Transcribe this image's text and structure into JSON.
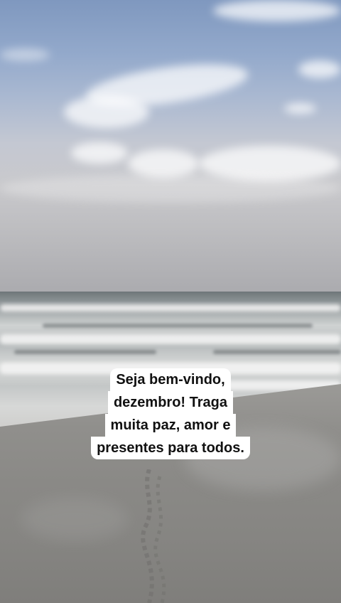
{
  "story": {
    "caption_lines": [
      "Seja bem-vindo,",
      "dezembro! Traga",
      "muita paz, amor e",
      "presentes para todos."
    ]
  },
  "colors": {
    "caption_background": "#ffffff",
    "caption_text": "#111111",
    "sky_top": "#7f98bf",
    "sand": "#8a8986"
  }
}
